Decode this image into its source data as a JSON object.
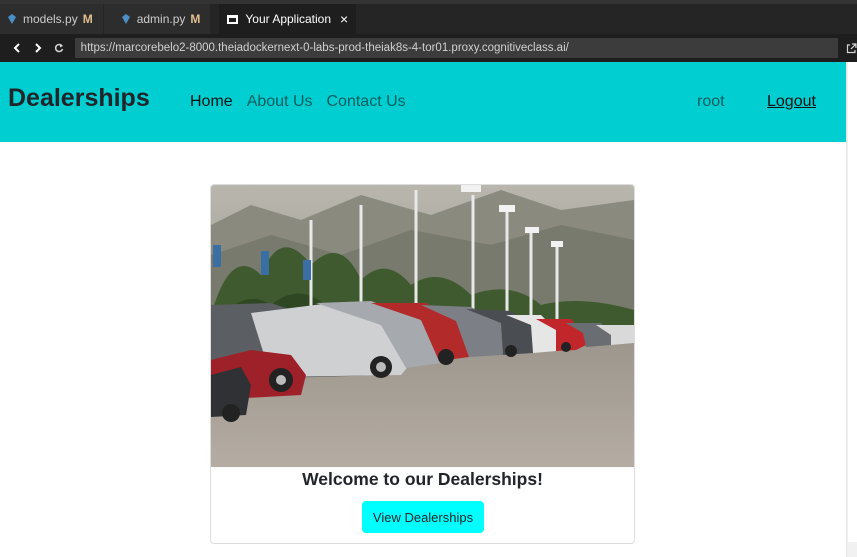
{
  "editor": {
    "tabs": [
      {
        "label": "models.py",
        "badge": "M",
        "icon": "python-file-icon"
      },
      {
        "label": "admin.py",
        "badge": "M",
        "icon": "python-file-icon"
      },
      {
        "label": "Your Application",
        "icon": "preview-icon",
        "close": "×"
      }
    ]
  },
  "browser": {
    "back_icon": "chevron-left-icon",
    "forward_icon": "chevron-right-icon",
    "reload_icon": "reload-icon",
    "url": "https://marcorebelo2-8000.theiadockernext-0-labs-prod-theiak8s-4-tor01.proxy.cognitiveclass.ai/",
    "open_external_icon": "open-external-icon"
  },
  "site": {
    "brand": "Dealerships",
    "nav": {
      "home": "Home",
      "about": "About Us",
      "contact": "Contact Us"
    },
    "user": "root",
    "logout": "Logout",
    "card": {
      "image": "parked-cars-photo",
      "title": "Welcome to our Dealerships!",
      "button": "View Dealerships"
    }
  },
  "colors": {
    "navbar_bg": "#00ced1",
    "button_bg": "#00ffff",
    "editor_bg": "#1e1e1e",
    "modified_badge": "#e2c08d"
  }
}
